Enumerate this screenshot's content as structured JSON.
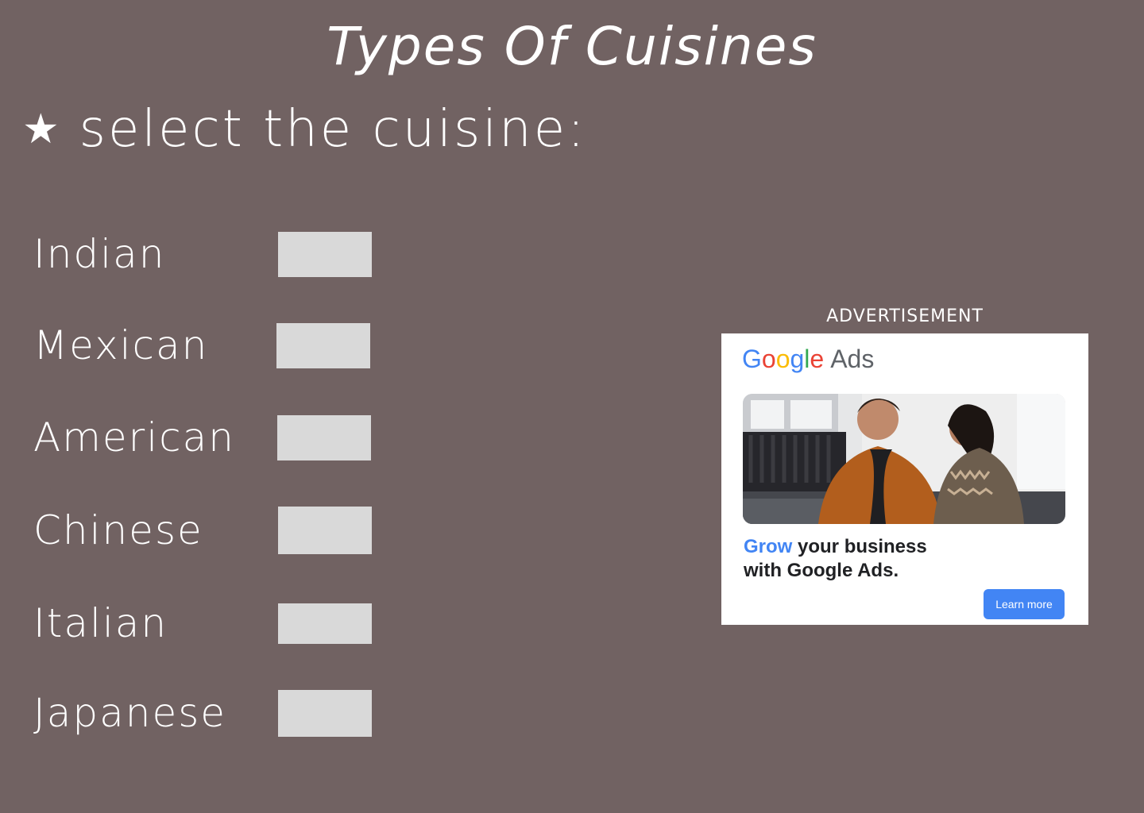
{
  "page": {
    "title": "Types Of Cuisines",
    "prompt": "select the cuisine:",
    "prompt_icon": "star-icon"
  },
  "cuisines": [
    {
      "label": "Indian"
    },
    {
      "label": "Mexican"
    },
    {
      "label": "American"
    },
    {
      "label": "Chinese"
    },
    {
      "label": "Italian"
    },
    {
      "label": "Japanese"
    }
  ],
  "ad": {
    "label": "ADVERTISEMENT",
    "brand_ads": "Ads",
    "headline_highlight": "Grow",
    "headline_line1_rest": " your business",
    "headline_line2": "with Google Ads.",
    "cta": "Learn more",
    "cta_color": "#4285f4"
  },
  "colors": {
    "background": "#716262",
    "selector_box": "#d9d9d9",
    "text": "#ffffff"
  }
}
